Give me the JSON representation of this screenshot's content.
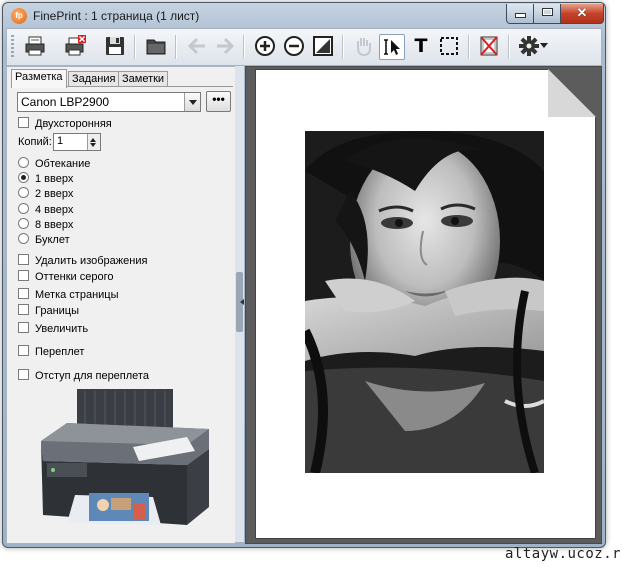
{
  "window": {
    "title": "FinePrint : 1 страница (1 лист)",
    "app_icon_text": "fp",
    "controls": [
      "minimize",
      "maximize",
      "close"
    ]
  },
  "toolbar": {
    "buttons": [
      {
        "name": "print-icon"
      },
      {
        "name": "print-delete-icon"
      },
      {
        "name": "save-icon"
      },
      {
        "name": "open-folder-icon"
      },
      {
        "name": "back-arrow-icon"
      },
      {
        "name": "forward-arrow-icon"
      },
      {
        "name": "zoom-in-icon"
      },
      {
        "name": "zoom-out-icon"
      },
      {
        "name": "fit-page-icon"
      },
      {
        "name": "hand-pan-icon"
      },
      {
        "name": "select-cursor-icon"
      },
      {
        "name": "text-tool-icon",
        "glyph": "T"
      },
      {
        "name": "marquee-select-icon"
      },
      {
        "name": "delete-page-icon"
      },
      {
        "name": "settings-gear-icon"
      }
    ]
  },
  "tabs": [
    {
      "label": "Разметка",
      "active": true
    },
    {
      "label": "Задания",
      "active": false
    },
    {
      "label": "Заметки",
      "active": false
    }
  ],
  "printer": {
    "selected": "Canon LBP2900",
    "more_label": "•••"
  },
  "options": {
    "duplex": {
      "label": "Двухсторонняя",
      "checked": false
    },
    "copies": {
      "label": "Копий:",
      "value": "1"
    },
    "layouts": [
      {
        "label": "Обтекание",
        "selected": false
      },
      {
        "label": "1 вверх",
        "selected": true
      },
      {
        "label": "2 вверх",
        "selected": false
      },
      {
        "label": "4 вверх",
        "selected": false
      },
      {
        "label": "8 вверх",
        "selected": false
      },
      {
        "label": "Буклет",
        "selected": false
      }
    ],
    "checks": [
      {
        "label": "Удалить изображения",
        "checked": false
      },
      {
        "label": "Оттенки серого",
        "checked": false
      },
      {
        "label": "Метка страницы",
        "checked": false
      },
      {
        "label": "Границы",
        "checked": false
      },
      {
        "label": "Увеличить",
        "checked": false
      },
      {
        "label": "Переплет",
        "checked": false
      },
      {
        "label": "Отступ для переплета",
        "checked": false
      }
    ]
  },
  "watermark": "altayw.ucoz.ru"
}
